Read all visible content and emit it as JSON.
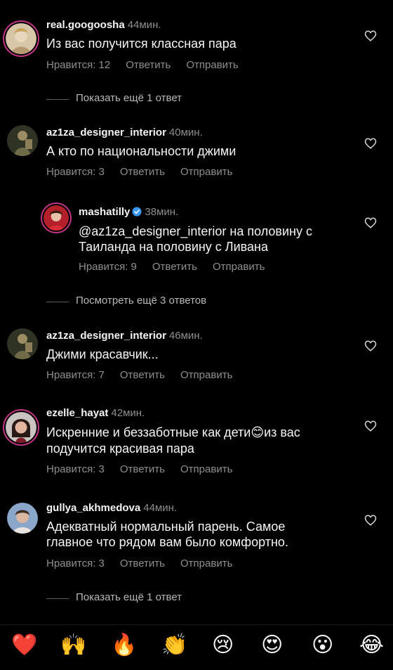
{
  "comments": [
    {
      "username": "real.googoosha",
      "time": "44мин.",
      "text": "Из вас получится классная пара",
      "likes": "Нравится: 12",
      "reply": "Ответить",
      "send": "Отправить"
    },
    {
      "username": "az1za_designer_interior",
      "time": "40мин.",
      "text": "А кто по национальности джими",
      "likes": "Нравится: 3",
      "reply": "Ответить",
      "send": "Отправить"
    },
    {
      "username": "mashatilly",
      "time": "38мин.",
      "text": "@az1za_designer_interior на половину с\nТаиланда на половину с Ливана",
      "likes": "Нравится: 9",
      "reply": "Ответить",
      "send": "Отправить"
    },
    {
      "username": "az1za_designer_interior",
      "time": "46мин.",
      "text": "Джими красавчик...",
      "likes": "Нравится: 7",
      "reply": "Ответить",
      "send": "Отправить"
    },
    {
      "username": "ezelle_hayat",
      "time": "42мин.",
      "text_line1": "Искренние и беззаботные как дети",
      "text_emoji": "😊",
      "text_line1_end": "из вас",
      "text_line2": "подучится красивая пара",
      "likes": "Нравится: 3",
      "reply": "Ответить",
      "send": "Отправить"
    },
    {
      "username": "gullya_akhmedova",
      "time": "44мин.",
      "text": "Адекватный нормальный парень. Самое\nглавное что рядом вам было комфортно.",
      "likes": "Нравится: 3",
      "reply": "Ответить",
      "send": "Отправить"
    }
  ],
  "more_replies": [
    "Показать ещё 1 ответ",
    "Посмотреть ещё 3 ответов",
    "Показать ещё 1 ответ"
  ],
  "reactions": [
    "❤️",
    "🙌",
    "🔥",
    "👏",
    "😢",
    "😍",
    "😮",
    "😂"
  ],
  "colors": {
    "background": "#000000",
    "secondary_text": "#8e8e8e",
    "verified": "#3897f0"
  },
  "icons": {
    "heart": "heart-outline-icon",
    "verified": "verified-badge-icon"
  }
}
